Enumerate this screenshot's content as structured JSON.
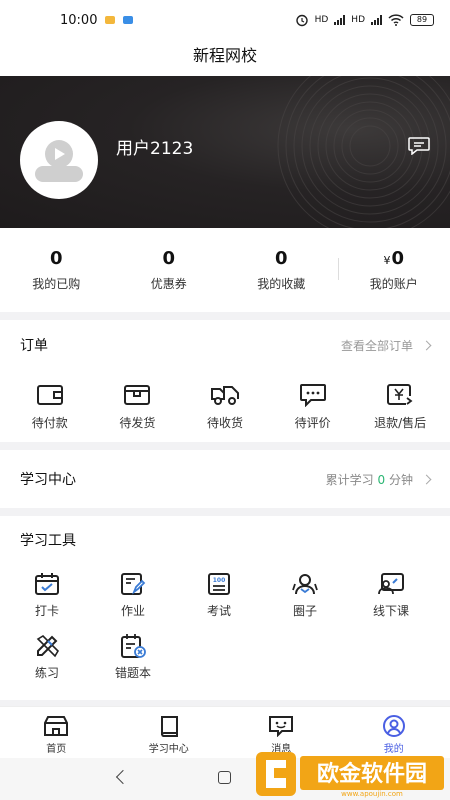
{
  "status_bar": {
    "time": "10:00",
    "battery": "89",
    "network_1": "HD",
    "network_2": "HD"
  },
  "app": {
    "title": "新程网校"
  },
  "profile": {
    "username": "用户2123"
  },
  "stats": [
    {
      "value": "0",
      "label": "我的已购"
    },
    {
      "value": "0",
      "label": "优惠券"
    },
    {
      "value": "0",
      "label": "我的收藏"
    },
    {
      "currency": "¥",
      "value": "0",
      "label": "我的账户"
    }
  ],
  "orders": {
    "title": "订单",
    "view_all": "查看全部订单",
    "items": [
      {
        "label": "待付款",
        "icon": "wallet-icon"
      },
      {
        "label": "待发货",
        "icon": "box-icon"
      },
      {
        "label": "待收货",
        "icon": "truck-icon"
      },
      {
        "label": "待评价",
        "icon": "comment-icon"
      },
      {
        "label": "退款/售后",
        "icon": "refund-icon"
      }
    ]
  },
  "study_center": {
    "title": "学习中心",
    "prefix": "累计学习",
    "minutes": "0",
    "suffix": "分钟"
  },
  "tools": {
    "title": "学习工具",
    "items": [
      {
        "label": "打卡",
        "icon": "calendar-check-icon"
      },
      {
        "label": "作业",
        "icon": "homework-icon"
      },
      {
        "label": "考试",
        "icon": "exam-icon"
      },
      {
        "label": "圈子",
        "icon": "group-icon"
      },
      {
        "label": "线下课",
        "icon": "offline-class-icon"
      },
      {
        "label": "练习",
        "icon": "practice-icon"
      },
      {
        "label": "错题本",
        "icon": "mistake-book-icon"
      }
    ]
  },
  "bottom_nav": [
    {
      "label": "首页",
      "icon": "home-icon"
    },
    {
      "label": "学习中心",
      "icon": "book-icon"
    },
    {
      "label": "消息",
      "icon": "message-icon"
    },
    {
      "label": "我的",
      "icon": "profile-icon",
      "active": true
    }
  ],
  "watermark": {
    "text": "欧金软件园",
    "url": "www.apoujin.com"
  },
  "colors": {
    "accent": "#4a5fe3",
    "study_green": "#2bb673",
    "header_dark": "#262324"
  }
}
